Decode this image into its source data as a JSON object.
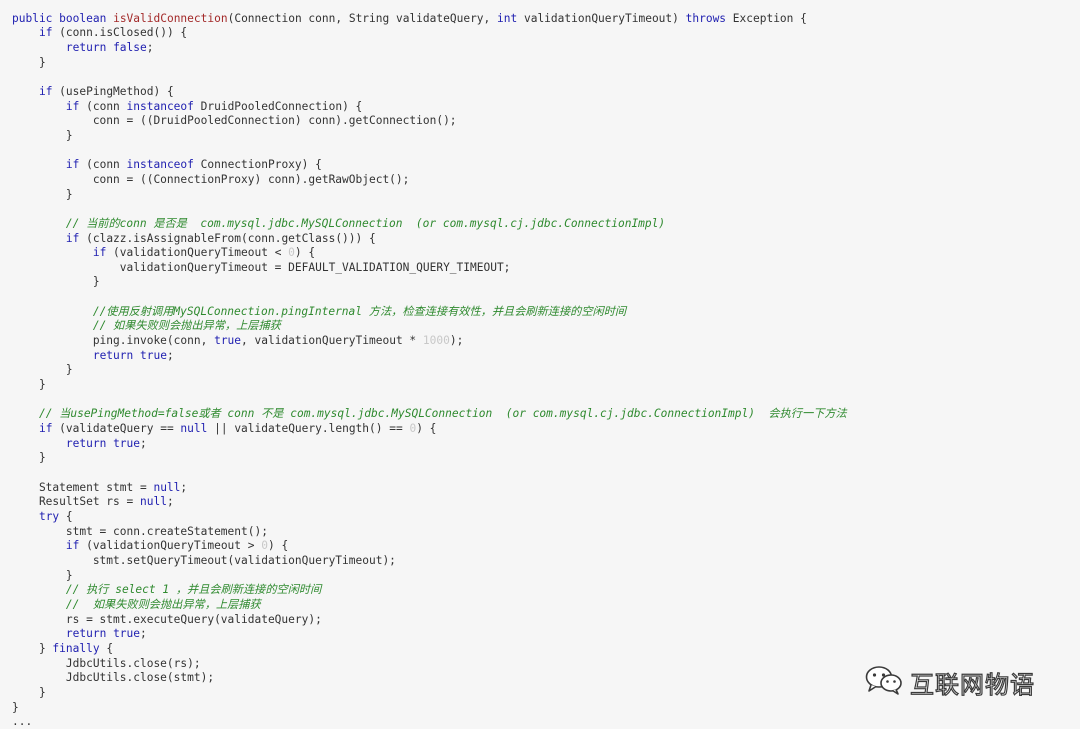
{
  "code_lines": [
    [
      [
        "",
        "                     "
      ]
    ],
    [
      [
        "kw",
        "public"
      ],
      [
        "",
        " "
      ],
      [
        "kw",
        "boolean"
      ],
      [
        "",
        " "
      ],
      [
        "fn",
        "isValidConnection"
      ],
      [
        "",
        "(Connection conn, String validateQuery, "
      ],
      [
        "kw",
        "int"
      ],
      [
        "",
        " validationQueryTimeout) "
      ],
      [
        "kw",
        "throws"
      ],
      [
        "",
        " Exception {"
      ]
    ],
    [
      [
        "",
        "    "
      ],
      [
        "kw",
        "if"
      ],
      [
        "",
        " (conn.isClosed()) {"
      ]
    ],
    [
      [
        "",
        "        "
      ],
      [
        "kw",
        "return"
      ],
      [
        "",
        " "
      ],
      [
        "kw",
        "false"
      ],
      [
        "",
        ";"
      ]
    ],
    [
      [
        "",
        "    }"
      ]
    ],
    [
      [
        "",
        ""
      ]
    ],
    [
      [
        "",
        "    "
      ],
      [
        "kw",
        "if"
      ],
      [
        "",
        " (usePingMethod) {"
      ]
    ],
    [
      [
        "",
        "        "
      ],
      [
        "kw",
        "if"
      ],
      [
        "",
        " (conn "
      ],
      [
        "kw",
        "instanceof"
      ],
      [
        "",
        " DruidPooledConnection) {"
      ]
    ],
    [
      [
        "",
        "            conn = ((DruidPooledConnection) conn).getConnection();"
      ]
    ],
    [
      [
        "",
        "        }"
      ]
    ],
    [
      [
        "",
        ""
      ]
    ],
    [
      [
        "",
        "        "
      ],
      [
        "kw",
        "if"
      ],
      [
        "",
        " (conn "
      ],
      [
        "kw",
        "instanceof"
      ],
      [
        "",
        " ConnectionProxy) {"
      ]
    ],
    [
      [
        "",
        "            conn = ((ConnectionProxy) conn).getRawObject();"
      ]
    ],
    [
      [
        "",
        "        }"
      ]
    ],
    [
      [
        "",
        ""
      ]
    ],
    [
      [
        "",
        "        "
      ],
      [
        "cm",
        "// 当前的conn 是否是  com.mysql.jdbc.MySQLConnection  (or com.mysql.cj.jdbc.ConnectionImpl)"
      ]
    ],
    [
      [
        "",
        "        "
      ],
      [
        "kw",
        "if"
      ],
      [
        "",
        " (clazz.isAssignableFrom(conn.getClass())) {"
      ]
    ],
    [
      [
        "",
        "            "
      ],
      [
        "kw",
        "if"
      ],
      [
        "",
        " (validationQueryTimeout < "
      ],
      [
        "num",
        "0"
      ],
      [
        "",
        ") {"
      ]
    ],
    [
      [
        "",
        "                validationQueryTimeout = DEFAULT_VALIDATION_QUERY_TIMEOUT;"
      ]
    ],
    [
      [
        "",
        "            }"
      ]
    ],
    [
      [
        "",
        ""
      ]
    ],
    [
      [
        "",
        "            "
      ],
      [
        "cm",
        "//使用反射调用MySQLConnection.pingInternal 方法，检查连接有效性，并且会刷新连接的空闲时间"
      ]
    ],
    [
      [
        "",
        "            "
      ],
      [
        "cm",
        "// 如果失败则会抛出异常，上层捕获"
      ]
    ],
    [
      [
        "",
        "            ping.invoke(conn, "
      ],
      [
        "kw",
        "true"
      ],
      [
        "",
        ", validationQueryTimeout * "
      ],
      [
        "num",
        "1000"
      ],
      [
        "",
        ");"
      ]
    ],
    [
      [
        "",
        "            "
      ],
      [
        "kw",
        "return"
      ],
      [
        "",
        " "
      ],
      [
        "kw",
        "true"
      ],
      [
        "",
        ";"
      ]
    ],
    [
      [
        "",
        "        }"
      ]
    ],
    [
      [
        "",
        "    }"
      ]
    ],
    [
      [
        "",
        ""
      ]
    ],
    [
      [
        "",
        "    "
      ],
      [
        "cm",
        "// 当usePingMethod=false或者 conn 不是 com.mysql.jdbc.MySQLConnection  (or com.mysql.cj.jdbc.ConnectionImpl)  会执行一下方法"
      ]
    ],
    [
      [
        "",
        "    "
      ],
      [
        "kw",
        "if"
      ],
      [
        "",
        " (validateQuery == "
      ],
      [
        "kw",
        "null"
      ],
      [
        "",
        " || validateQuery.length() == "
      ],
      [
        "num",
        "0"
      ],
      [
        "",
        ") {"
      ]
    ],
    [
      [
        "",
        "        "
      ],
      [
        "kw",
        "return"
      ],
      [
        "",
        " "
      ],
      [
        "kw",
        "true"
      ],
      [
        "",
        ";"
      ]
    ],
    [
      [
        "",
        "    }"
      ]
    ],
    [
      [
        "",
        ""
      ]
    ],
    [
      [
        "",
        "    Statement stmt = "
      ],
      [
        "kw",
        "null"
      ],
      [
        "",
        ";"
      ]
    ],
    [
      [
        "",
        "    ResultSet rs = "
      ],
      [
        "kw",
        "null"
      ],
      [
        "",
        ";"
      ]
    ],
    [
      [
        "",
        "    "
      ],
      [
        "kw",
        "try"
      ],
      [
        "",
        " {"
      ]
    ],
    [
      [
        "",
        "        stmt = conn.createStatement();"
      ]
    ],
    [
      [
        "",
        "        "
      ],
      [
        "kw",
        "if"
      ],
      [
        "",
        " (validationQueryTimeout > "
      ],
      [
        "num",
        "0"
      ],
      [
        "",
        ") {"
      ]
    ],
    [
      [
        "",
        "            stmt.setQueryTimeout(validationQueryTimeout);"
      ]
    ],
    [
      [
        "",
        "        }"
      ]
    ],
    [
      [
        "",
        "        "
      ],
      [
        "cm",
        "// 执行 select 1 ，并且会刷新连接的空闲时间"
      ]
    ],
    [
      [
        "",
        "        "
      ],
      [
        "cm",
        "//  如果失败则会抛出异常，上层捕获"
      ]
    ],
    [
      [
        "",
        "        rs = stmt.executeQuery(validateQuery);"
      ]
    ],
    [
      [
        "",
        "        "
      ],
      [
        "kw",
        "return"
      ],
      [
        "",
        " "
      ],
      [
        "kw",
        "true"
      ],
      [
        "",
        ";"
      ]
    ],
    [
      [
        "",
        "    } "
      ],
      [
        "kw",
        "finally"
      ],
      [
        "",
        " {"
      ]
    ],
    [
      [
        "",
        "        JdbcUtils.close(rs);"
      ]
    ],
    [
      [
        "",
        "        JdbcUtils.close(stmt);"
      ]
    ],
    [
      [
        "",
        "    }"
      ]
    ],
    [
      [
        "",
        "}"
      ]
    ],
    [
      [
        "",
        "..."
      ]
    ]
  ],
  "watermark": {
    "icon": "wechat-icon",
    "text": "互联网物语"
  },
  "colors": {
    "background": "#f6f6f6",
    "keyword": "#1f1fb0",
    "function": "#a32a2a",
    "comment": "#2f8a2f",
    "number": "#c8c8c8",
    "text": "#333333"
  }
}
